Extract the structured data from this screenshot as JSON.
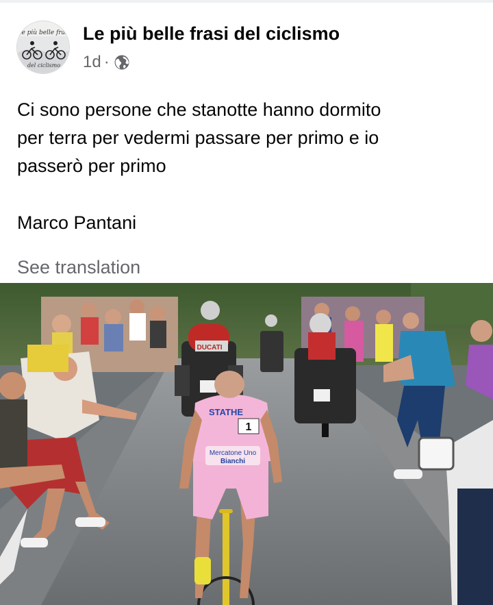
{
  "post": {
    "page_name": "Le più belle frasi del ciclismo",
    "timestamp": "1d",
    "separator": "·",
    "privacy_icon": "globe-icon",
    "text_lines": [
      "Ci sono persone che stanotte hanno dormito",
      "per terra per vedermi passare per primo e io",
      "passerò per primo"
    ],
    "author": "Marco Pantani",
    "translation_link": "See translation"
  },
  "avatar": {
    "logo_text_top": "Le più belle frasi",
    "logo_text_bottom": "del ciclismo"
  },
  "photo": {
    "jersey_text_top": "STATHE",
    "jersey_number": "1",
    "jersey_sponsor": "Mercatone Uno",
    "jersey_bike": "Bianchi",
    "moto_label": "DUCATI"
  },
  "colors": {
    "text_primary": "#050505",
    "text_secondary": "#65676b",
    "jersey_pink": "#f4b6d8"
  }
}
